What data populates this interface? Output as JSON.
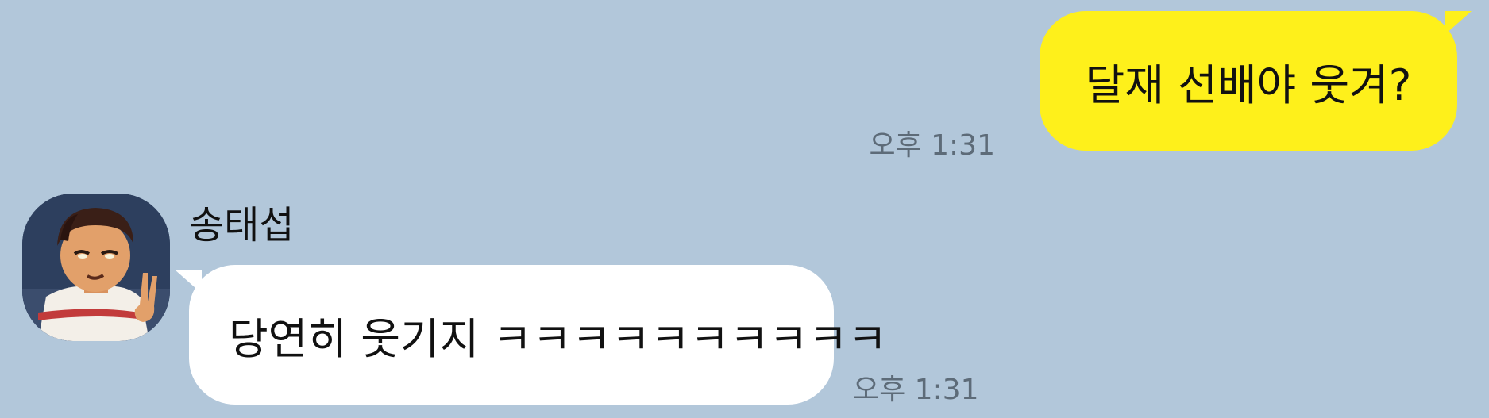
{
  "chat": {
    "messages": [
      {
        "direction": "outgoing",
        "text": "달재 선배야 웃겨?",
        "time": "오후 1:31",
        "bubble_color": "#fef01b"
      },
      {
        "direction": "incoming",
        "sender": "송태섭",
        "avatar": "profile-avatar-icon",
        "text": "당연히 웃기지 ㅋㅋㅋㅋㅋㅋㅋㅋㅋㅋ",
        "time": "오후 1:31",
        "bubble_color": "#ffffff"
      }
    ],
    "background_color": "#b2c7da"
  }
}
